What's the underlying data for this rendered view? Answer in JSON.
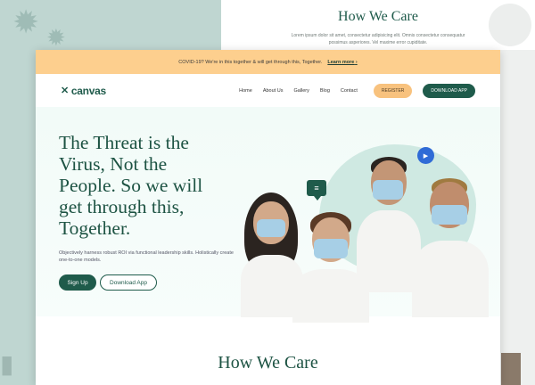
{
  "background": {
    "title": "How We Care",
    "subtitle": "Lorem ipsum dolor sit amet, consectetur adipisicing elit. Omnis consectetur consequatur possimus asperiores. Vel maxime error cupiditate."
  },
  "banner": {
    "text": "COVID-19? We're in this together & will get through this, Together.",
    "link_label": "Learn more",
    "link_icon": "chevron-right-icon"
  },
  "nav": {
    "logo_text": "canvas",
    "links": [
      "Home",
      "About Us",
      "Gallery",
      "Blog",
      "Contact"
    ],
    "register_label": "REGISTER",
    "download_label": "DOWNLOAD APP"
  },
  "hero": {
    "headline": "The Threat is the Virus, Not the People. So we will get through this, Together.",
    "subtext": "Objectively harness robust ROI via functional leadership skills. Holistically create one-to-one models.",
    "signup_label": "Sign Up",
    "download_app_label": "Download App"
  },
  "section": {
    "title": "How We Care"
  },
  "colors": {
    "brand": "#1f5b4b",
    "banner": "#fdcf8e",
    "accent": "#f8c27e",
    "play": "#2f6bd6"
  }
}
